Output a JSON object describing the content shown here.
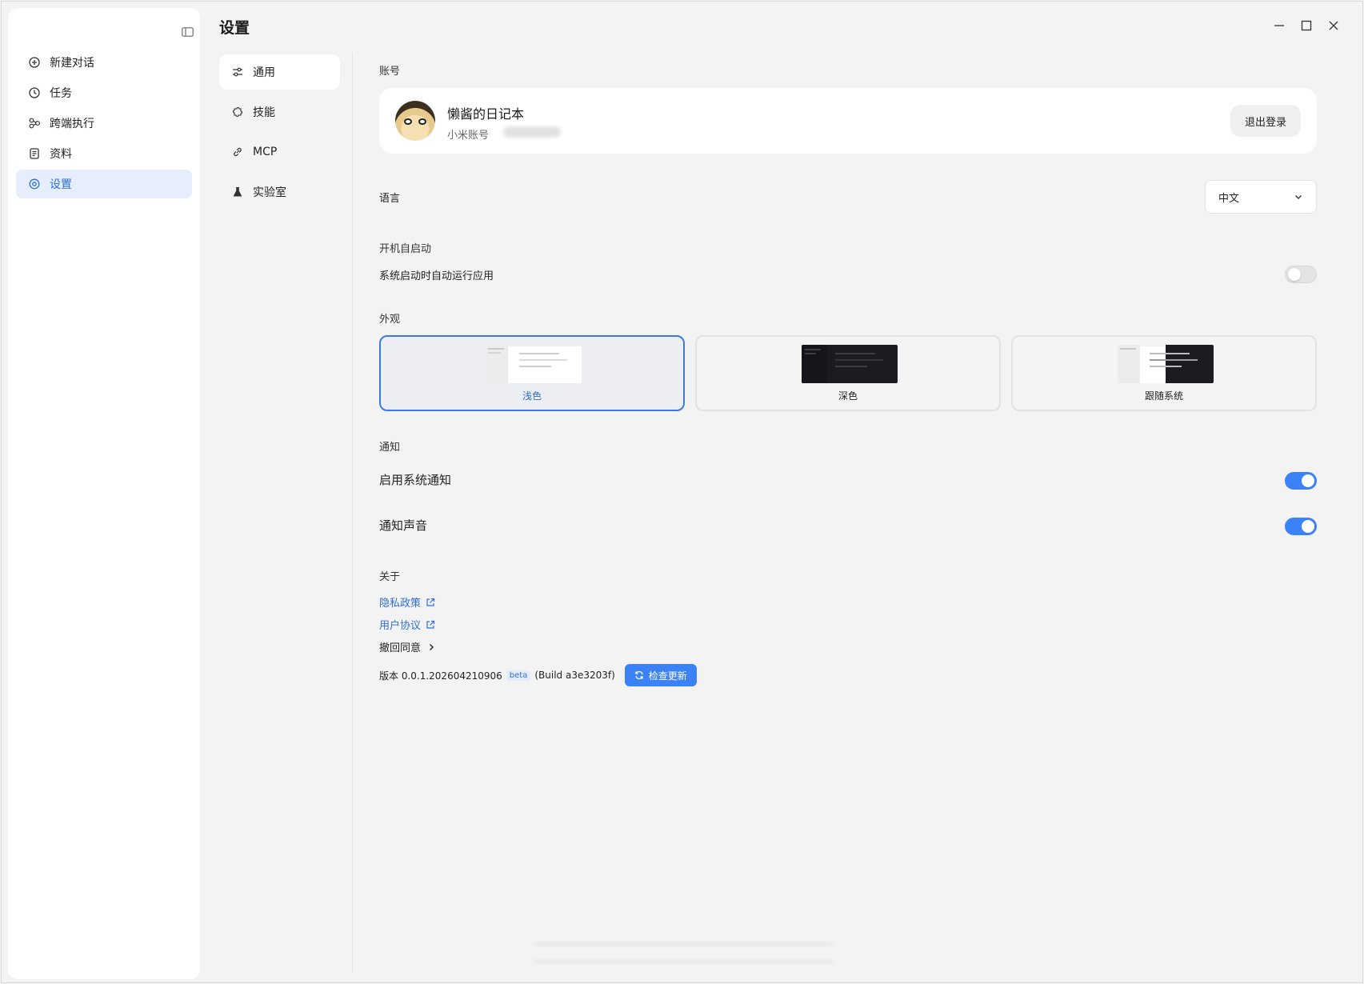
{
  "sidebar": {
    "items": [
      {
        "label": "新建对话",
        "icon": "plus-circle-icon"
      },
      {
        "label": "任务",
        "icon": "clock-icon"
      },
      {
        "label": "跨端执行",
        "icon": "network-icon"
      },
      {
        "label": "资料",
        "icon": "document-icon"
      },
      {
        "label": "设置",
        "icon": "settings-icon",
        "active": true
      }
    ]
  },
  "header": {
    "title": "设置"
  },
  "subnav": {
    "items": [
      {
        "label": "通用",
        "icon": "sliders-icon",
        "active": true
      },
      {
        "label": "技能",
        "icon": "puzzle-icon"
      },
      {
        "label": "MCP",
        "icon": "link-icon"
      },
      {
        "label": "实验室",
        "icon": "flask-icon"
      }
    ]
  },
  "account": {
    "section": "账号",
    "name": "懒酱的日记本",
    "sub_label": "小米账号",
    "logout_label": "退出登录"
  },
  "language": {
    "label": "语言",
    "value": "中文"
  },
  "startup": {
    "section": "开机自启动",
    "option": "系统启动时自动运行应用",
    "enabled": false
  },
  "appearance": {
    "section": "外观",
    "themes": [
      {
        "label": "浅色",
        "selected": true
      },
      {
        "label": "深色",
        "selected": false
      },
      {
        "label": "跟随系统",
        "selected": false
      }
    ]
  },
  "notifications": {
    "section": "通知",
    "system": {
      "label": "启用系统通知",
      "enabled": true
    },
    "sound": {
      "label": "通知声音",
      "enabled": true
    }
  },
  "about": {
    "section": "关于",
    "privacy": "隐私政策",
    "terms": "用户协议",
    "revoke": "撤回同意",
    "version_text": "版本 0.0.1.202604210906",
    "beta": "beta",
    "build": "(Build a3e3203f)",
    "update_label": "检查更新"
  },
  "colors": {
    "accent": "#3b82f6",
    "active_bg": "#e6eefb",
    "link": "#2f6fd6"
  }
}
